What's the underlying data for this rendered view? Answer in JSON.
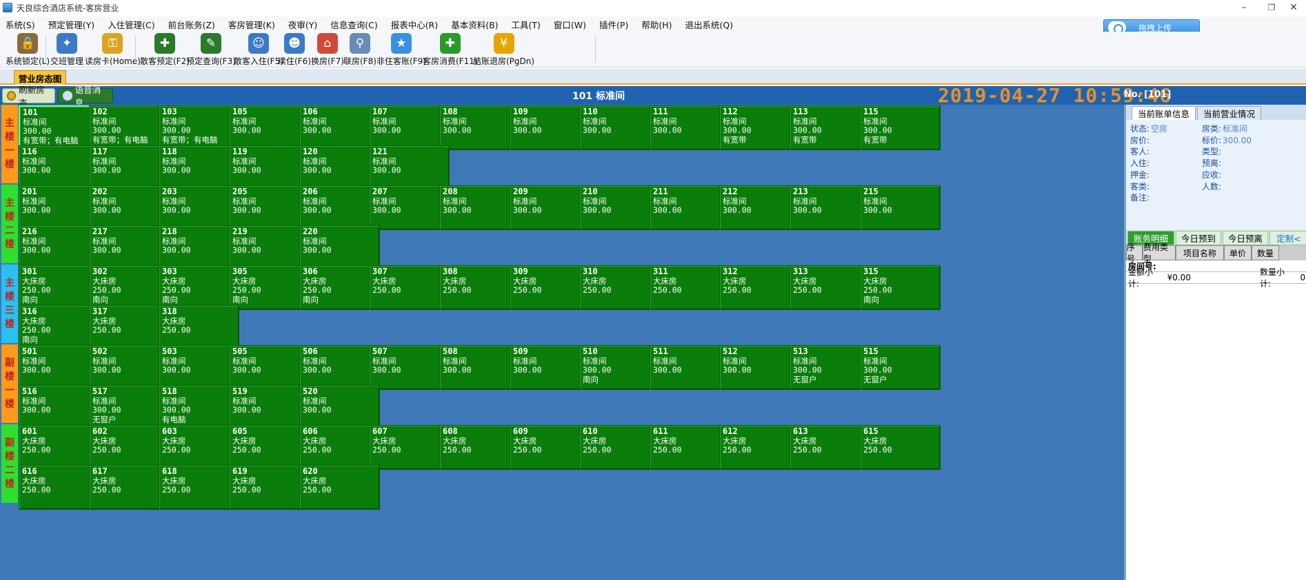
{
  "window": {
    "title": "天良综合酒店系统-客房营业",
    "minimize": "–",
    "restore": "❐",
    "close": "✕"
  },
  "menu": [
    "系统(S)",
    "预定管理(Y)",
    "入住管理(C)",
    "前台账务(Z)",
    "客房管理(K)",
    "夜审(Y)",
    "信息查询(C)",
    "报表中心(R)",
    "基本资料(B)",
    "工具(T)",
    "窗口(W)",
    "插件(P)",
    "帮助(H)",
    "退出系统(Q)"
  ],
  "upload_button": "拖拽上传",
  "toolbar": [
    {
      "label": "系统锁定(L)",
      "icon": "lock-icon",
      "color": "#8a6a3a",
      "glyph": "🔒"
    },
    {
      "label": "交班管理",
      "icon": "wand-icon",
      "color": "#3c7ac8",
      "glyph": "✦"
    },
    {
      "label": "读房卡(Home)",
      "icon": "key-card-icon",
      "color": "#d9a520",
      "glyph": "⚿"
    },
    {
      "label": "散客预定(F2)",
      "icon": "booking-add-icon",
      "color": "#2a7a2a",
      "glyph": "✚"
    },
    {
      "label": "预定查询(F3)",
      "icon": "booking-search-icon",
      "color": "#2a7a2a",
      "glyph": "✎"
    },
    {
      "label": "散客入住(F5)",
      "icon": "guest-add-icon",
      "color": "#3c7ac8",
      "glyph": "☺"
    },
    {
      "label": "续住(F6)",
      "icon": "stay-extend-icon",
      "color": "#3c7ac8",
      "glyph": "☻"
    },
    {
      "label": "换房(F7)",
      "icon": "room-change-icon",
      "color": "#d04a3a",
      "glyph": "⌂"
    },
    {
      "label": "联房(F8)",
      "icon": "room-link-icon",
      "color": "#6a8ab8",
      "glyph": "⚲"
    },
    {
      "label": "非住客账(F9)",
      "icon": "star-folder-icon",
      "color": "#3a90e0",
      "glyph": "★"
    },
    {
      "label": "客房消费(F11)",
      "icon": "consumption-icon",
      "color": "#2a9a2a",
      "glyph": "✚"
    },
    {
      "label": "结账退房(PgDn)",
      "icon": "checkout-icon",
      "color": "#e6a500",
      "glyph": "¥"
    }
  ],
  "tab": "营业房态图",
  "header": {
    "refresh": "刷新房态",
    "voice": "语音消息",
    "current_room": "101  标准间",
    "datetime": "2019-04-27  10:59:46",
    "no_label": "No.  [101]"
  },
  "floors": [
    {
      "label": "主楼一楼",
      "rooms": [
        [
          "101",
          "标准间",
          "300.00",
          "有宽带；有电脑"
        ],
        [
          "102",
          "标准间",
          "300.00",
          "有宽带；有电脑"
        ],
        [
          "103",
          "标准间",
          "300.00",
          "有宽带；有电脑"
        ],
        [
          "105",
          "标准间",
          "300.00",
          ""
        ],
        [
          "106",
          "标准间",
          "300.00",
          ""
        ],
        [
          "107",
          "标准间",
          "300.00",
          ""
        ],
        [
          "108",
          "标准间",
          "300.00",
          ""
        ],
        [
          "109",
          "标准间",
          "300.00",
          ""
        ],
        [
          "110",
          "标准间",
          "300.00",
          ""
        ],
        [
          "111",
          "标准间",
          "300.00",
          ""
        ],
        [
          "112",
          "标准间",
          "300.00",
          "有宽带"
        ],
        [
          "113",
          "标准间",
          "300.00",
          "有宽带"
        ],
        [
          "115",
          "标准间",
          "300.00",
          "有宽带"
        ],
        [
          "116",
          "标准间",
          "300.00",
          ""
        ],
        [
          "117",
          "标准间",
          "300.00",
          ""
        ],
        [
          "118",
          "标准间",
          "300.00",
          ""
        ],
        [
          "119",
          "标准间",
          "300.00",
          ""
        ],
        [
          "120",
          "标准间",
          "300.00",
          ""
        ],
        [
          "121",
          "标准间",
          "300.00",
          ""
        ]
      ]
    },
    {
      "label": "主楼二楼",
      "rooms": [
        [
          "201",
          "标准间",
          "300.00",
          ""
        ],
        [
          "202",
          "标准间",
          "300.00",
          ""
        ],
        [
          "203",
          "标准间",
          "300.00",
          ""
        ],
        [
          "205",
          "标准间",
          "300.00",
          ""
        ],
        [
          "206",
          "标准间",
          "300.00",
          ""
        ],
        [
          "207",
          "标准间",
          "300.00",
          ""
        ],
        [
          "208",
          "标准间",
          "300.00",
          ""
        ],
        [
          "209",
          "标准间",
          "300.00",
          ""
        ],
        [
          "210",
          "标准间",
          "300.00",
          ""
        ],
        [
          "211",
          "标准间",
          "300.00",
          ""
        ],
        [
          "212",
          "标准间",
          "300.00",
          ""
        ],
        [
          "213",
          "标准间",
          "300.00",
          ""
        ],
        [
          "215",
          "标准间",
          "300.00",
          ""
        ],
        [
          "216",
          "标准间",
          "300.00",
          ""
        ],
        [
          "217",
          "标准间",
          "300.00",
          ""
        ],
        [
          "218",
          "标准间",
          "300.00",
          ""
        ],
        [
          "219",
          "标准间",
          "300.00",
          ""
        ],
        [
          "220",
          "标准间",
          "300.00",
          ""
        ]
      ]
    },
    {
      "label": "主楼三楼",
      "rooms": [
        [
          "301",
          "大床房",
          "250.00",
          "南向"
        ],
        [
          "302",
          "大床房",
          "250.00",
          "南向"
        ],
        [
          "303",
          "大床房",
          "250.00",
          "南向"
        ],
        [
          "305",
          "大床房",
          "250.00",
          "南向"
        ],
        [
          "306",
          "大床房",
          "250.00",
          "南向"
        ],
        [
          "307",
          "大床房",
          "250.00",
          ""
        ],
        [
          "308",
          "大床房",
          "250.00",
          ""
        ],
        [
          "309",
          "大床房",
          "250.00",
          ""
        ],
        [
          "310",
          "大床房",
          "250.00",
          ""
        ],
        [
          "311",
          "大床房",
          "250.00",
          ""
        ],
        [
          "312",
          "大床房",
          "250.00",
          ""
        ],
        [
          "313",
          "大床房",
          "250.00",
          ""
        ],
        [
          "315",
          "大床房",
          "250.00",
          "南向"
        ],
        [
          "316",
          "大床房",
          "250.00",
          "南向"
        ],
        [
          "317",
          "大床房",
          "250.00",
          ""
        ],
        [
          "318",
          "大床房",
          "250.00",
          ""
        ]
      ]
    },
    {
      "label": "副楼一楼",
      "rooms": [
        [
          "501",
          "标准间",
          "300.00",
          ""
        ],
        [
          "502",
          "标准间",
          "300.00",
          ""
        ],
        [
          "503",
          "标准间",
          "300.00",
          ""
        ],
        [
          "505",
          "标准间",
          "300.00",
          ""
        ],
        [
          "506",
          "标准间",
          "300.00",
          ""
        ],
        [
          "507",
          "标准间",
          "300.00",
          ""
        ],
        [
          "508",
          "标准间",
          "300.00",
          ""
        ],
        [
          "509",
          "标准间",
          "300.00",
          ""
        ],
        [
          "510",
          "标准间",
          "300.00",
          "南向"
        ],
        [
          "511",
          "标准间",
          "300.00",
          ""
        ],
        [
          "512",
          "标准间",
          "300.00",
          ""
        ],
        [
          "513",
          "标准间",
          "300.00",
          "无窗户"
        ],
        [
          "515",
          "标准间",
          "300.00",
          "无窗户"
        ],
        [
          "516",
          "标准间",
          "300.00",
          ""
        ],
        [
          "517",
          "标准间",
          "300.00",
          "无窗户"
        ],
        [
          "518",
          "标准间",
          "300.00",
          "有电脑"
        ],
        [
          "519",
          "标准间",
          "300.00",
          ""
        ],
        [
          "520",
          "标准间",
          "300.00",
          ""
        ]
      ]
    },
    {
      "label": "副楼二楼",
      "rooms": [
        [
          "601",
          "大床房",
          "250.00",
          ""
        ],
        [
          "602",
          "大床房",
          "250.00",
          ""
        ],
        [
          "603",
          "大床房",
          "250.00",
          ""
        ],
        [
          "605",
          "大床房",
          "250.00",
          ""
        ],
        [
          "606",
          "大床房",
          "250.00",
          ""
        ],
        [
          "607",
          "大床房",
          "250.00",
          ""
        ],
        [
          "608",
          "大床房",
          "250.00",
          ""
        ],
        [
          "609",
          "大床房",
          "250.00",
          ""
        ],
        [
          "610",
          "大床房",
          "250.00",
          ""
        ],
        [
          "611",
          "大床房",
          "250.00",
          ""
        ],
        [
          "612",
          "大床房",
          "250.00",
          ""
        ],
        [
          "613",
          "大床房",
          "250.00",
          ""
        ],
        [
          "615",
          "大床房",
          "250.00",
          ""
        ],
        [
          "616",
          "大床房",
          "250.00",
          ""
        ],
        [
          "617",
          "大床房",
          "250.00",
          ""
        ],
        [
          "618",
          "大床房",
          "250.00",
          ""
        ],
        [
          "619",
          "大床房",
          "250.00",
          ""
        ],
        [
          "620",
          "大床房",
          "250.00",
          ""
        ]
      ]
    }
  ],
  "floor_colors": [
    "#ff9a1a",
    "#2ee02e",
    "#2ac0f0",
    "#ff9a1a",
    "#2ee02e",
    "#2ac0f0"
  ],
  "right_panel": {
    "tabs": [
      "当前账单信息",
      "当前营业情况"
    ],
    "fields": [
      {
        "label": "状态:",
        "value": "空房"
      },
      {
        "label": "房类:",
        "value": "标准间"
      },
      {
        "label": "房价:",
        "value": ""
      },
      {
        "label": "标价:",
        "value": "300.00"
      },
      {
        "label": "客人:",
        "value": ""
      },
      {
        "label": "类型:",
        "value": ""
      },
      {
        "label": "入住:",
        "value": ""
      },
      {
        "label": "预离:",
        "value": ""
      },
      {
        "label": "押金:",
        "value": ""
      },
      {
        "label": "应收:",
        "value": ""
      },
      {
        "label": "客类:",
        "value": ""
      },
      {
        "label": "人数:",
        "value": ""
      },
      {
        "label": "备注:",
        "value": ""
      }
    ],
    "bottom_tabs": [
      "账务明细",
      "今日预到",
      "今日预离",
      "定制<"
    ],
    "columns": [
      "序号",
      "费用类型",
      "项目名称",
      "单价",
      "数量"
    ],
    "room_no_label": "房间号:",
    "amount_label": "金额小计:",
    "amount_value": "¥0.00",
    "qty_label": "数量小计:",
    "qty_value": "0."
  }
}
